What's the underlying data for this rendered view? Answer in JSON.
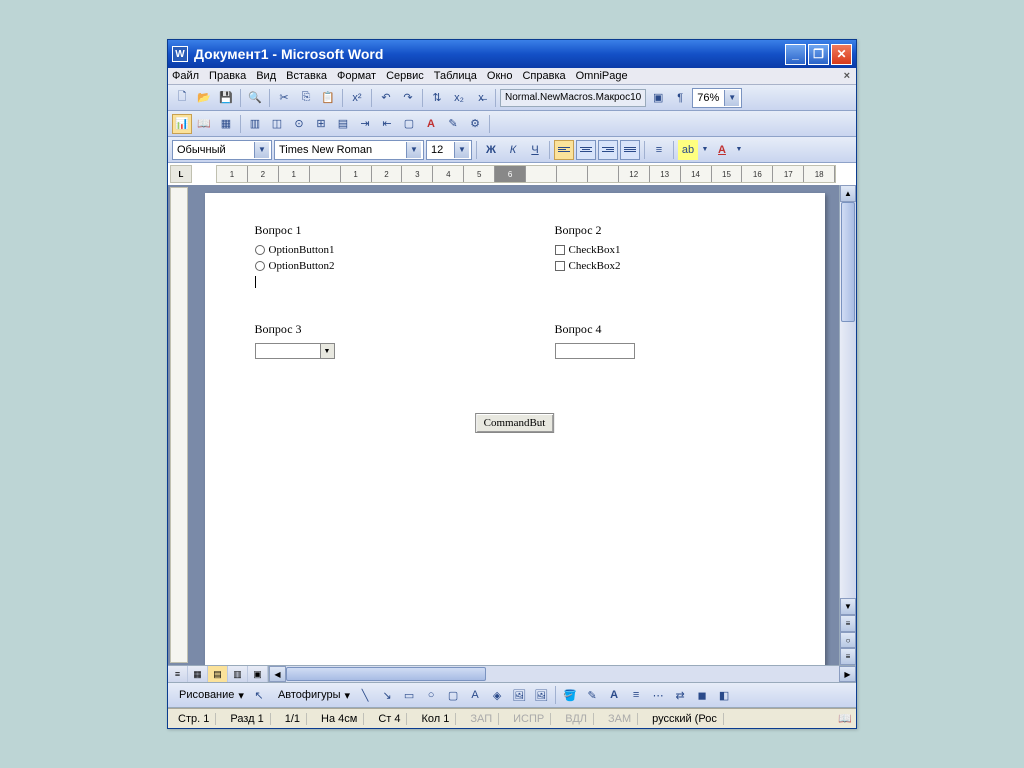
{
  "window": {
    "title": "Документ1 - Microsoft Word"
  },
  "menu": [
    "Файл",
    "Правка",
    "Вид",
    "Вставка",
    "Формат",
    "Сервис",
    "Таблица",
    "Окно",
    "Справка",
    "OmniPage"
  ],
  "toolbar1": {
    "macro_name": "Normal.NewMacros.Макрос10",
    "zoom": "76%"
  },
  "formatting": {
    "style": "Обычный",
    "font": "Times New Roman",
    "size": "12",
    "bold": "Ж",
    "italic": "К",
    "underline": "Ч"
  },
  "document": {
    "q1": {
      "title": "Вопрос 1",
      "opt1": "OptionButton1",
      "opt2": "OptionButton2"
    },
    "q2": {
      "title": "Вопрос 2",
      "chk1": "CheckBox1",
      "chk2": "CheckBox2"
    },
    "q3": {
      "title": "Вопрос 3"
    },
    "q4": {
      "title": "Вопрос 4"
    },
    "button": "CommandBut"
  },
  "drawing": {
    "label": "Рисование",
    "autoshapes": "Автофигуры"
  },
  "status": {
    "page": "Стр. 1",
    "section": "Разд 1",
    "pages": "1/1",
    "at": "На 4см",
    "line": "Ст 4",
    "col": "Кол 1",
    "rec": "ЗАП",
    "trk": "ИСПР",
    "ext": "ВДЛ",
    "ovr": "ЗАМ",
    "lang": "русский (Рос"
  }
}
